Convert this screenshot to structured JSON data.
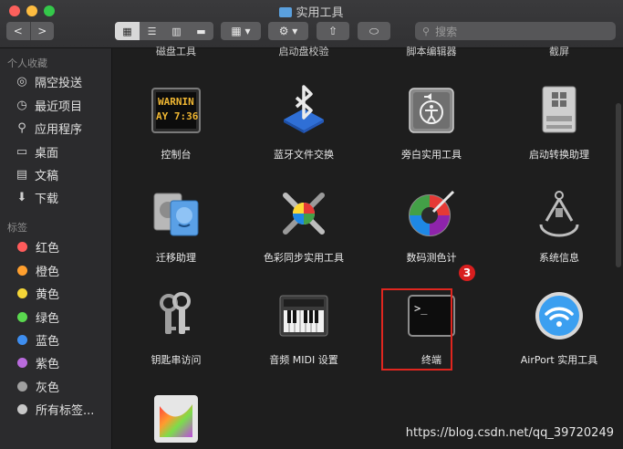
{
  "window": {
    "title": "实用工具"
  },
  "toolbar": {
    "back": "<",
    "forward": ">",
    "view_icons": "▦",
    "view_list": "☰",
    "view_columns": "▥",
    "view_gallery": "▬",
    "group": "▦ ▾",
    "action": "⚙ ▾",
    "share": "⇧",
    "tag": "⬭",
    "search_placeholder": "搜索"
  },
  "sidebar": {
    "favorites_header": "个人收藏",
    "favorites": [
      {
        "label": "隔空投送",
        "icon": "airdrop-icon",
        "glyph": "◎"
      },
      {
        "label": "最近项目",
        "icon": "clock-icon",
        "glyph": "◷"
      },
      {
        "label": "应用程序",
        "icon": "applications-icon",
        "glyph": "⚲"
      },
      {
        "label": "桌面",
        "icon": "desktop-icon",
        "glyph": "▭"
      },
      {
        "label": "文稿",
        "icon": "document-icon",
        "glyph": "▤"
      },
      {
        "label": "下载",
        "icon": "download-icon",
        "glyph": "⬇"
      }
    ],
    "tags_header": "标签",
    "tags": [
      {
        "label": "红色",
        "color": "#ff5b5b"
      },
      {
        "label": "橙色",
        "color": "#ff9f2e"
      },
      {
        "label": "黄色",
        "color": "#f5d638"
      },
      {
        "label": "绿色",
        "color": "#5ad84f"
      },
      {
        "label": "蓝色",
        "color": "#3e8ef0"
      },
      {
        "label": "紫色",
        "color": "#b96bdd"
      },
      {
        "label": "灰色",
        "color": "#a0a0a0"
      }
    ],
    "all_tags": "所有标签..."
  },
  "content": {
    "top_row": [
      "磁盘工具",
      "启动盘校验",
      "脚本编辑器",
      "截屏"
    ],
    "apps": [
      {
        "label": "控制台",
        "icon": "console-icon",
        "console_text_1": "WARNIN",
        "console_text_2": "AY 7:36"
      },
      {
        "label": "蓝牙文件交换",
        "icon": "bluetooth-icon"
      },
      {
        "label": "旁白实用工具",
        "icon": "voiceover-icon"
      },
      {
        "label": "启动转换助理",
        "icon": "bootcamp-icon"
      },
      {
        "label": "迁移助理",
        "icon": "migration-icon"
      },
      {
        "label": "色彩同步实用工具",
        "icon": "colorsync-icon"
      },
      {
        "label": "数码测色计",
        "icon": "colormeter-icon"
      },
      {
        "label": "系统信息",
        "icon": "system-info-icon"
      },
      {
        "label": "钥匙串访问",
        "icon": "keychain-icon"
      },
      {
        "label": "音频 MIDI 设置",
        "icon": "midi-icon"
      },
      {
        "label": "终端",
        "icon": "terminal-icon",
        "prompt": ">_"
      },
      {
        "label": "AirPort 实用工具",
        "icon": "airport-icon"
      },
      {
        "label": "",
        "icon": "grapher-icon"
      }
    ],
    "annotation_badge": "3"
  },
  "watermark": "https://blog.csdn.net/qq_39720249",
  "colors": {
    "highlight": "#e0261f",
    "badge": "#d81e1e",
    "folder": "#5aa0de"
  }
}
